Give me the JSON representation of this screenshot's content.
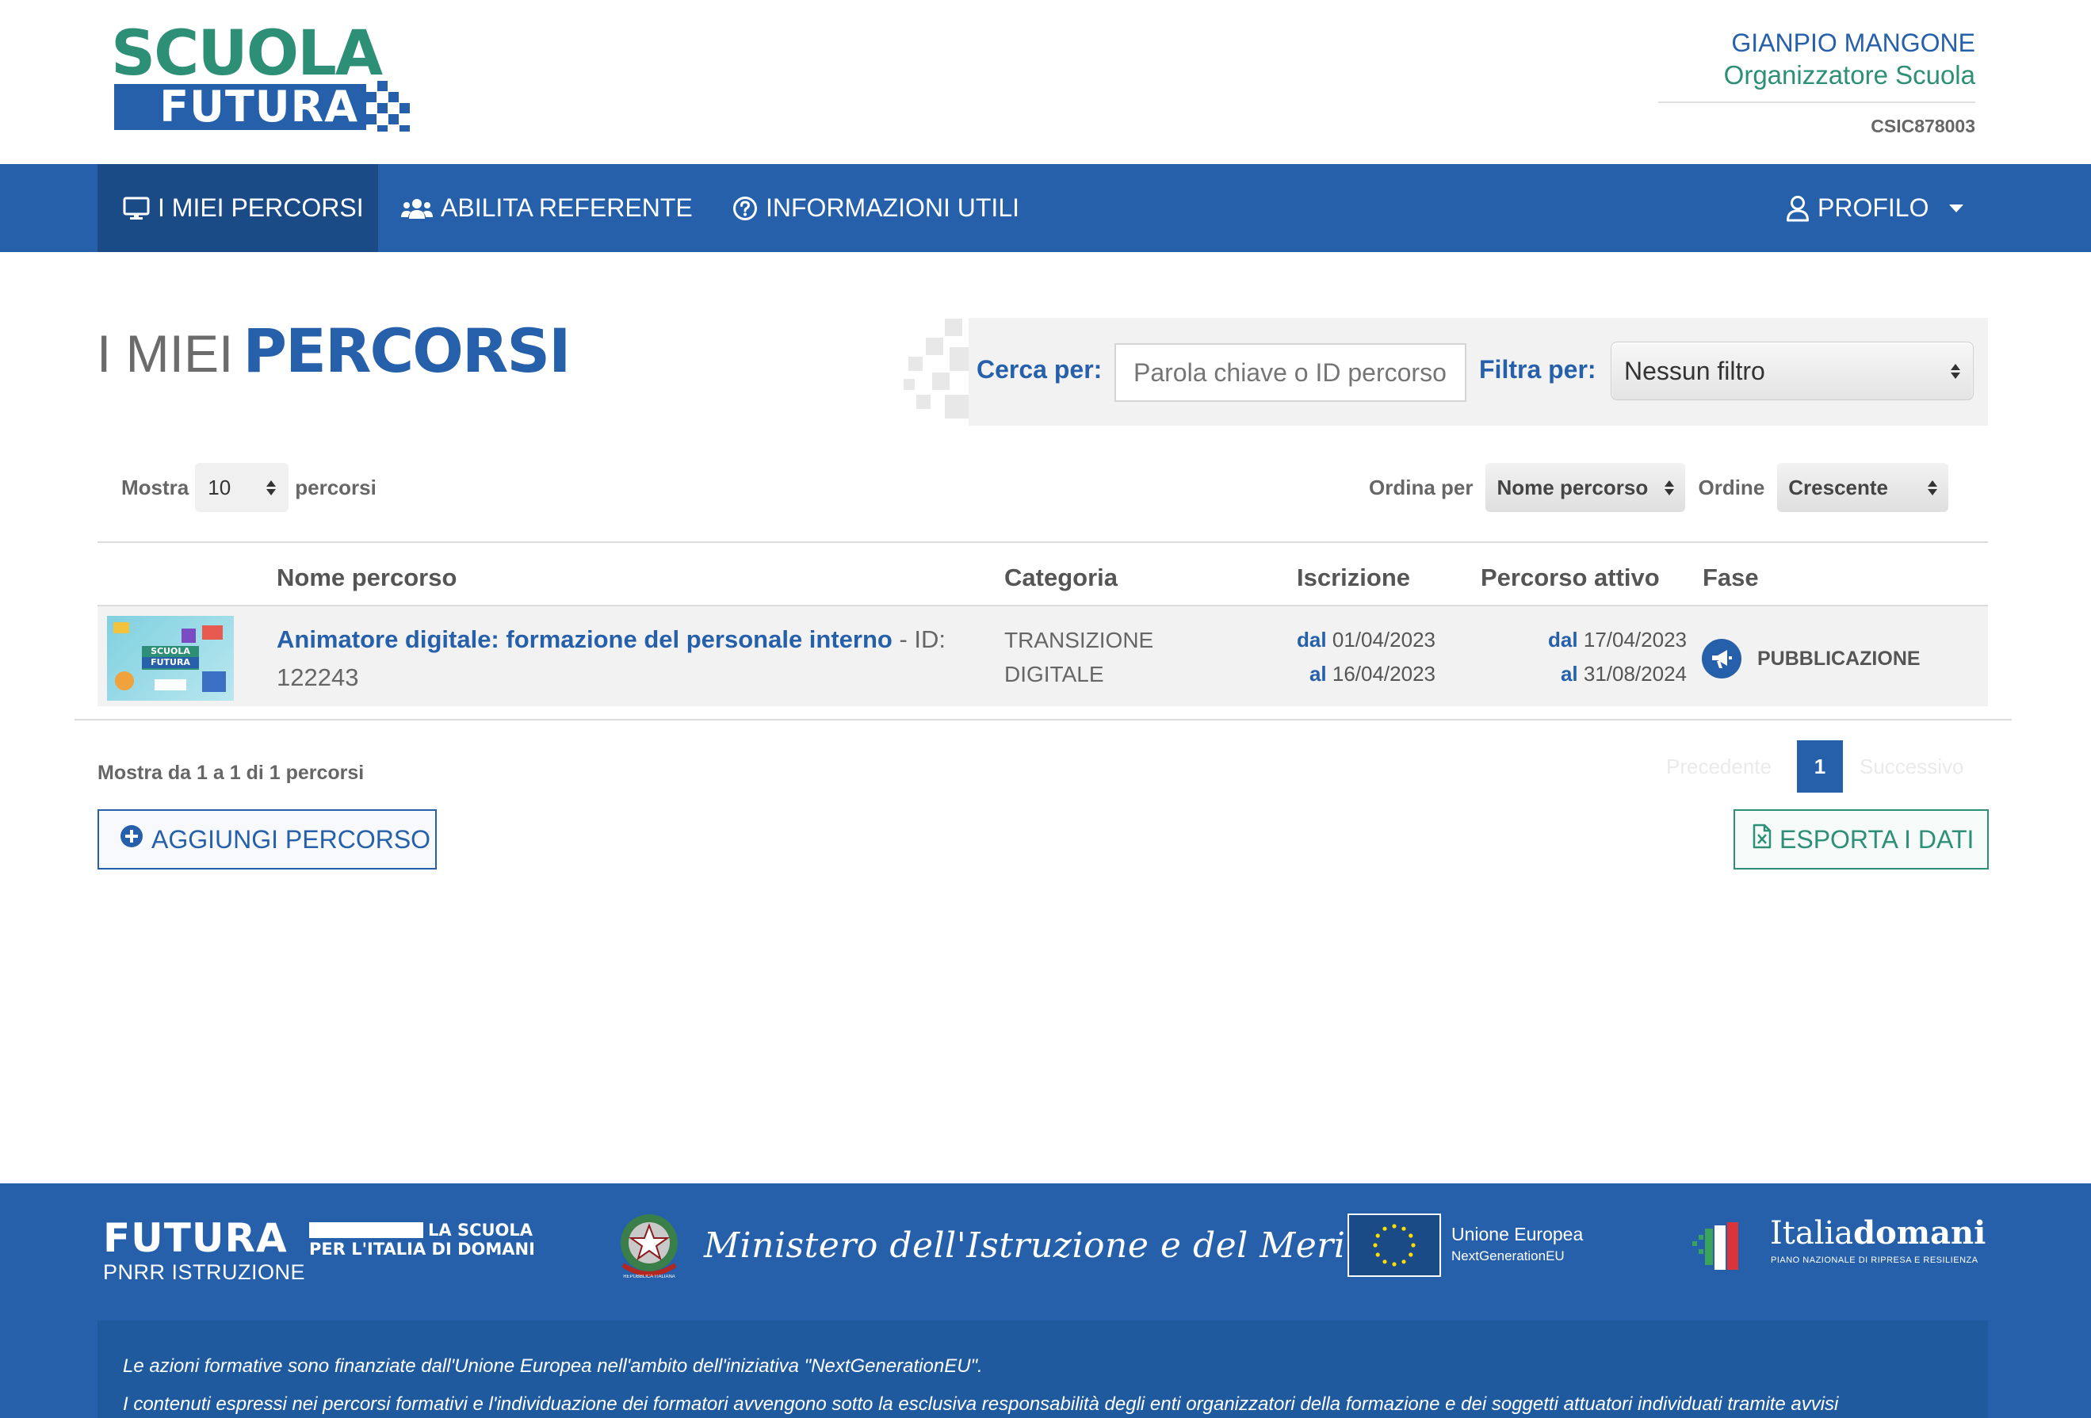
{
  "logo": {
    "line1": "SCUOLA",
    "line2": "FUTURA"
  },
  "user": {
    "name": "GIANPIO MANGONE",
    "role": "Organizzatore Scuola",
    "code": "CSIC878003"
  },
  "nav": {
    "items": [
      {
        "label": "I MIEI PERCORSI",
        "icon": "monitor-icon"
      },
      {
        "label": "ABILITA REFERENTE",
        "icon": "users-icon"
      },
      {
        "label": "INFORMAZIONI UTILI",
        "icon": "help-circle-icon"
      }
    ],
    "profile": {
      "label": "PROFILO",
      "icon": "user-icon"
    }
  },
  "title": {
    "light": "I MIEI",
    "bold": "PERCORSI"
  },
  "search": {
    "label": "Cerca per:",
    "placeholder": "Parola chiave o ID percorso",
    "filter_label": "Filtra per:",
    "filter_value": "Nessun filtro"
  },
  "listing": {
    "show_label": "Mostra",
    "show_value": "10",
    "show_suffix": "percorsi",
    "order_by_label": "Ordina per",
    "order_by_value": "Nome percorso",
    "order_label": "Ordine",
    "order_value": "Crescente"
  },
  "table": {
    "headers": [
      "Nome percorso",
      "Categoria",
      "Iscrizione",
      "Percorso attivo",
      "Fase"
    ],
    "rows": [
      {
        "name": "Animatore digitale: formazione del personale interno",
        "id_text": " - ID: 122243",
        "category": "TRANSIZIONE DIGITALE",
        "iscr_dal_label": "dal",
        "iscr_dal": "01/04/2023",
        "iscr_al_label": "al",
        "iscr_al": "16/04/2023",
        "att_dal_label": "dal",
        "att_dal": "17/04/2023",
        "att_al_label": "al",
        "att_al": "31/08/2024",
        "phase": "PUBBLICAZIONE",
        "phase_icon": "megaphone-icon",
        "thumb_text": "SCUOLA FUTURA"
      }
    ]
  },
  "pagination": {
    "summary": "Mostra da 1 a 1 di 1 percorsi",
    "prev": "Precedente",
    "current": "1",
    "next": "Successivo"
  },
  "buttons": {
    "add": "AGGIUNGI PERCORSO",
    "export": "ESPORTA I DATI"
  },
  "footer": {
    "futura": "FUTURA",
    "futura_sub": "PNRR ISTRUZIONE",
    "slogan_1": "LA SCUOLA",
    "slogan_2": "PER L'ITALIA DI DOMANI",
    "emblem_text": "REPUBBLICA ITALIANA",
    "ministero": "Ministero dell'Istruzione e del Merito",
    "eu_1": "Unione Europea",
    "eu_2": "NextGenerationEU",
    "italia_1": "Italia",
    "italia_2": "domani",
    "italia_sub": "PIANO NAZIONALE DI RIPRESA E RESILIENZA",
    "notice_1": "Le azioni formative sono finanziate dall'Unione Europea nell'ambito dell'iniziativa \"NextGenerationEU\".",
    "notice_2": "I contenuti espressi nei percorsi formativi e l'individuazione dei formatori avvengono sotto la esclusiva responsabilità degli enti organizzatori della formazione e dei soggetti attuatori individuati tramite avvisi"
  },
  "colors": {
    "primary": "#2660aa",
    "primary_dark": "#1b4b86",
    "green": "#2e8f77",
    "row_bg": "#f2f2f2"
  }
}
